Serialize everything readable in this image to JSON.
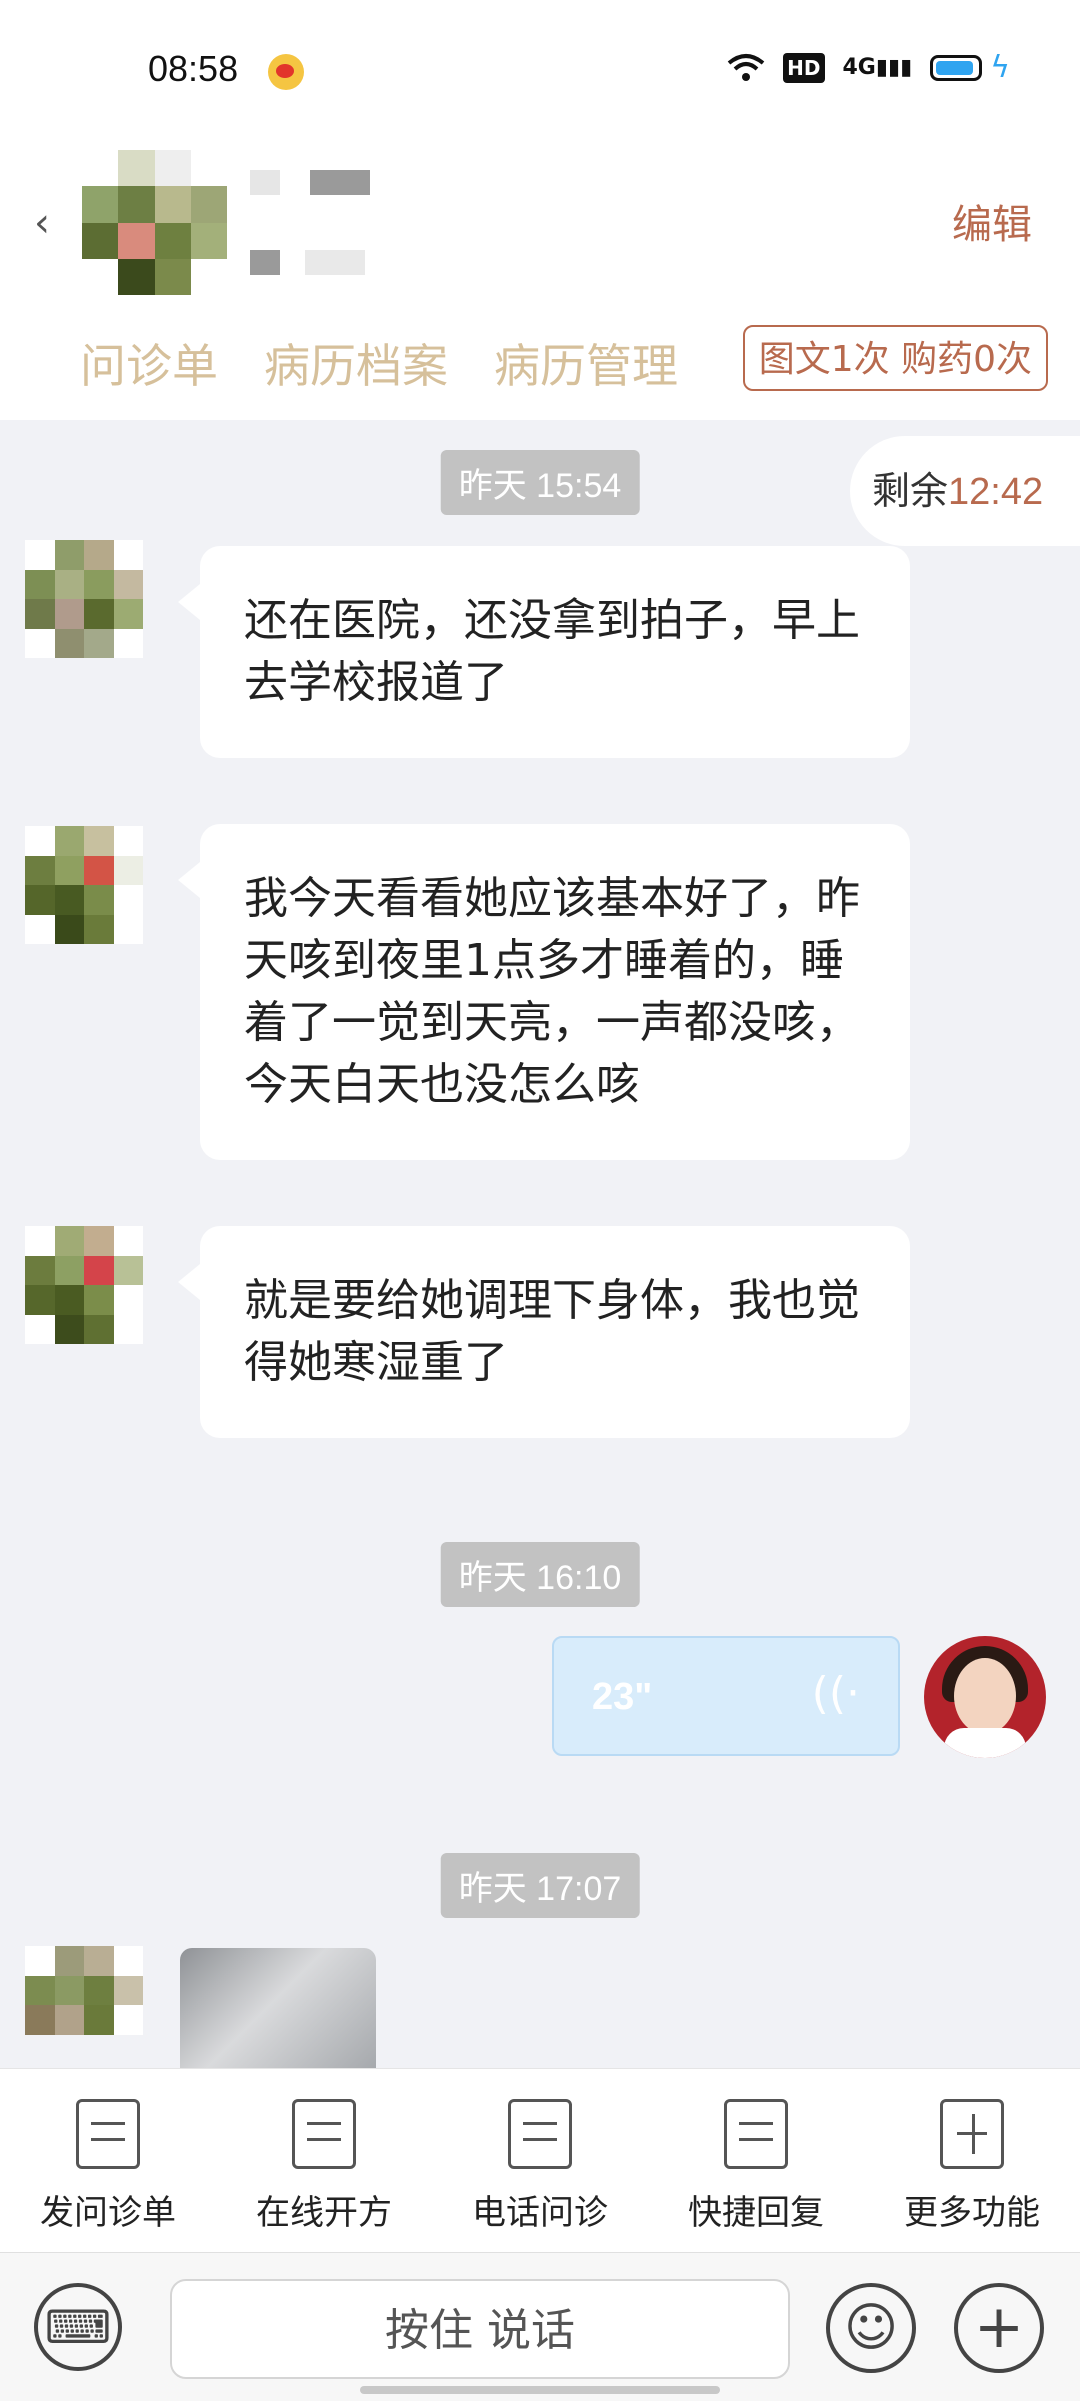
{
  "status_bar": {
    "time": "08:58",
    "network": "4G",
    "hd": "HD"
  },
  "header": {
    "edit_label": "编辑",
    "tabs": [
      "问诊单",
      "病历档案",
      "病历管理"
    ],
    "quota": "图文1次 购药0次"
  },
  "chat": {
    "remaining_label": "剩余",
    "remaining_time": "12:42",
    "timestamps": [
      "昨天 15:54",
      "昨天 16:10",
      "昨天 17:07"
    ],
    "messages": [
      "还在医院，还没拿到拍子，早上去学校报道了",
      "我今天看看她应该基本好了，昨天咳到夜里1点多才睡着的，睡着了一觉到天亮，一声都没咳，今天白天也没怎么咳",
      "就是要给她调理下身体，我也觉得她寒湿重了"
    ],
    "voice_duration": "23\""
  },
  "toolbar": {
    "items": [
      "发问诊单",
      "在线开方",
      "电话问诊",
      "快捷回复",
      "更多功能"
    ]
  },
  "input": {
    "hold_to_talk": "按住 说话"
  }
}
